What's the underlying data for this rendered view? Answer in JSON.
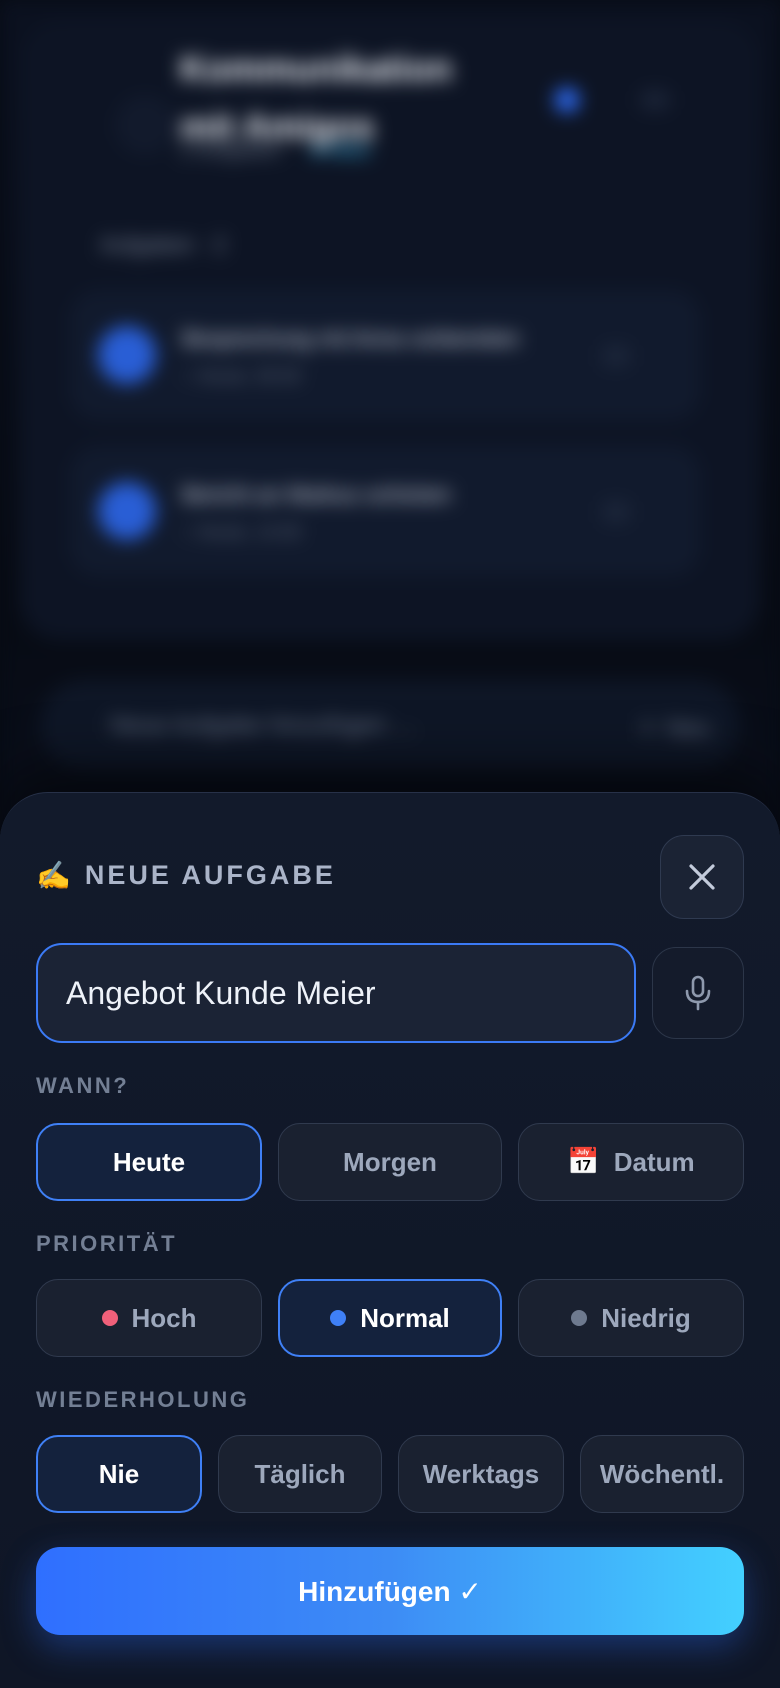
{
  "background": {
    "title": "Kommunikation mit Amigos",
    "subtitle": "2 Aufgaben",
    "tag": "● Aktiv",
    "section": "Aufgaben · 2",
    "tasks": [
      {
        "title": "Besprechung mit Anna vorbereiten",
        "meta": "○ Heute, 09:00"
      },
      {
        "title": "Bericht an Markus schicken",
        "meta": "○ Heute, 14:00"
      }
    ],
    "quick_add": "Neue Aufgabe hinzufügen …",
    "quick_add_button": "＋ Neu"
  },
  "sheet": {
    "emoji": "✍️",
    "title": "NEUE AUFGABE",
    "input_value": "Angebot Kunde Meier",
    "when": {
      "label": "WANN?",
      "options": [
        "Heute",
        "Morgen",
        "Datum"
      ],
      "date_icon": "📅",
      "selected": "Heute"
    },
    "priority": {
      "label": "PRIORITÄT",
      "options": [
        {
          "label": "Hoch",
          "color": "#f0607a"
        },
        {
          "label": "Normal",
          "color": "#3f80f6"
        },
        {
          "label": "Niedrig",
          "color": "#6e7a8f"
        }
      ],
      "selected": "Normal"
    },
    "repeat": {
      "label": "WIEDERHOLUNG",
      "options": [
        "Nie",
        "Täglich",
        "Werktags",
        "Wöchentl."
      ],
      "selected": "Nie"
    },
    "submit_label": "Hinzufügen ✓"
  },
  "colors": {
    "accent": "#3f80f6",
    "gradient_end": "#43d0ff",
    "sheet_bg": "#121a2b"
  }
}
